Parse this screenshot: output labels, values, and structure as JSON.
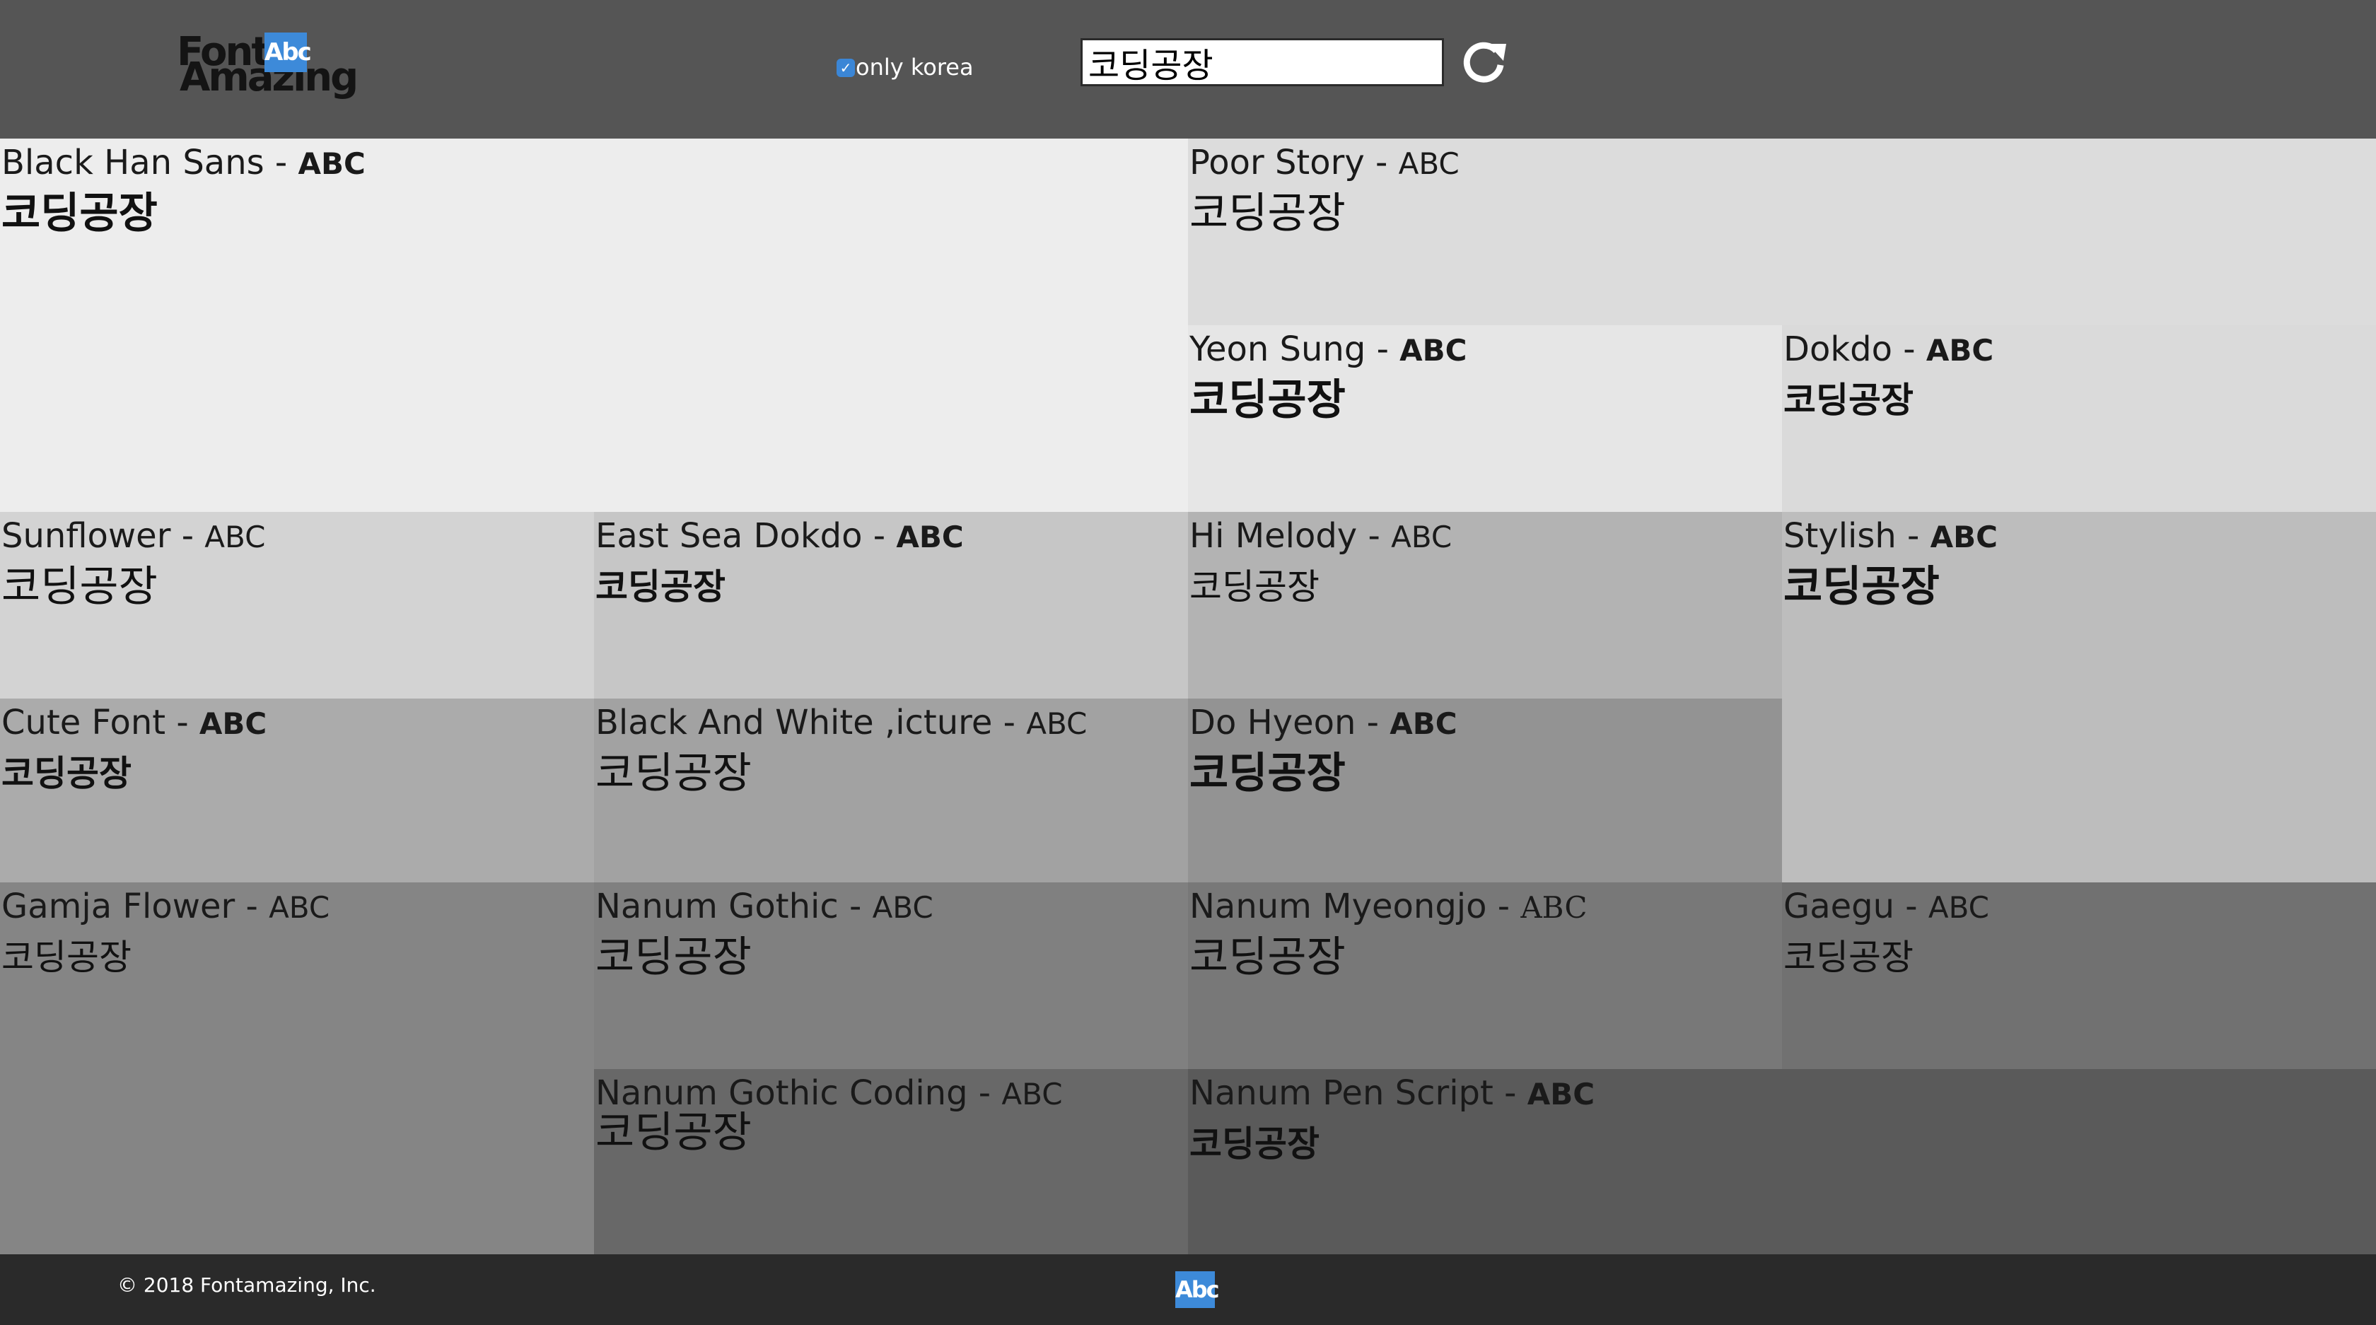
{
  "header": {
    "logo": {
      "word1": "Font",
      "word2": "Amazing",
      "badge": "Abc"
    },
    "checkbox": {
      "label": "only korea",
      "checked": true
    },
    "search": {
      "value": "코딩공장"
    },
    "refresh_icon": "refresh-icon"
  },
  "tiles": [
    {
      "name": "Black Han Sans",
      "sep": " - ",
      "abc": "ABC",
      "sample": "코딩공장",
      "color": "#ededed"
    },
    {
      "name": "Poor Story",
      "sep": " - ",
      "abc": "ABC",
      "sample": "코딩공장",
      "color": "#dcdcdc"
    },
    {
      "name": "Yeon Sung",
      "sep": " - ",
      "abc": "ABC",
      "sample": "코딩공장",
      "color": "#e6e6e6"
    },
    {
      "name": "Dokdo",
      "sep": " - ",
      "abc": "ABC",
      "sample": "코딩공장",
      "color": "#dadada"
    },
    {
      "name": "Sunflower",
      "sep": " - ",
      "abc": "ABC",
      "sample": "코딩공장",
      "color": "#d3d3d3"
    },
    {
      "name": "East Sea Dokdo",
      "sep": " - ",
      "abc": "ABC",
      "sample": "코딩공장",
      "color": "#c6c6c6"
    },
    {
      "name": "Hi Melody",
      "sep": " - ",
      "abc": "ABC",
      "sample": "코딩공장",
      "color": "#b3b3b3"
    },
    {
      "name": "Stylish",
      "sep": " - ",
      "abc": "ABC",
      "sample": "코딩공장",
      "color": "#bdbdbd"
    },
    {
      "name": "Cute Font",
      "sep": " - ",
      "abc": "ABC",
      "sample": "코딩공장",
      "color": "#ababab"
    },
    {
      "name": "Black And White ,icture",
      "sep": " - ",
      "abc": "ABC",
      "sample": "코딩공장",
      "color": "#a2a2a2"
    },
    {
      "name": "Do Hyeon",
      "sep": " - ",
      "abc": "ABC",
      "sample": "코딩공장",
      "color": "#939393"
    },
    {
      "name": "Gamja Flower",
      "sep": " - ",
      "abc": "ABC",
      "sample": "코딩공장",
      "color": "#858585"
    },
    {
      "name": "Nanum Gothic",
      "sep": " - ",
      "abc": "ABC",
      "sample": "코딩공장",
      "color": "#808080"
    },
    {
      "name": "Nanum Myeongjo",
      "sep": " - ",
      "abc": "ABC",
      "sample": "코딩공장",
      "color": "#787878"
    },
    {
      "name": "Gaegu",
      "sep": " - ",
      "abc": "ABC",
      "sample": "코딩공장",
      "color": "#717171"
    },
    {
      "name": "Nanum Gothic Coding",
      "sep": " - ",
      "abc": "ABC",
      "sample": "코딩공장",
      "color": "#686868"
    },
    {
      "name": "Nanum Pen Script",
      "sep": " - ",
      "abc": "ABC",
      "sample": "코딩공장",
      "color": "#5a5a5a"
    }
  ],
  "footer": {
    "copyright": "© 2018 Fontamazing, Inc.",
    "logo_badge": "Abc"
  }
}
